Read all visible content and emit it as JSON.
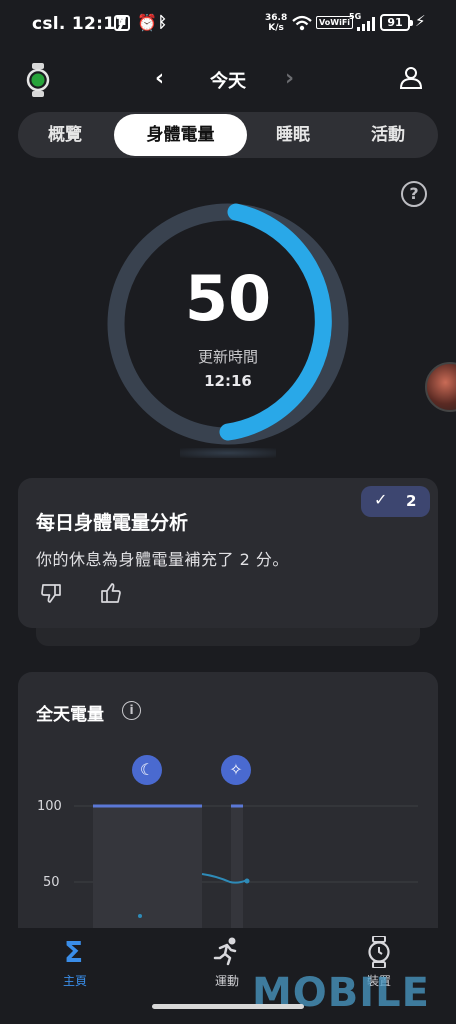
{
  "status_bar": {
    "time": "csl. 12:17",
    "net_speed_top": "36.8",
    "net_speed_unit": "K/s",
    "vowifi": "VoWiFi",
    "network": "5G",
    "battery": "91"
  },
  "header": {
    "title": "今天",
    "prev_icon": "chevron-left-icon",
    "next_icon": "chevron-right-icon",
    "watch_icon": "watch-icon",
    "profile_icon": "person-icon"
  },
  "tabs": [
    {
      "label": "概覽",
      "active": false
    },
    {
      "label": "身體電量",
      "active": true
    },
    {
      "label": "睡眠",
      "active": false
    },
    {
      "label": "活動",
      "active": false
    }
  ],
  "gauge": {
    "value": "50",
    "level_fraction": 0.5,
    "label": "更新時間",
    "time": "12:16",
    "accent": "#29a8e8"
  },
  "insight_card": {
    "title": "每日身體電量分析",
    "text": "你的休息為身體電量補充了 2 分。",
    "badge_count": "2"
  },
  "day_chart_card": {
    "title": "全天電量",
    "y_labels": [
      "100",
      "50"
    ]
  },
  "chart_data": {
    "type": "line",
    "title": "全天電量",
    "xlabel": "",
    "ylabel": "",
    "ylim": [
      0,
      100
    ],
    "yticks": [
      100,
      50
    ],
    "grid": true,
    "series": [
      {
        "values": [
          100,
          100,
          55,
          52,
          50,
          50,
          50
        ]
      }
    ]
  },
  "bottom_nav": [
    {
      "label": "主頁",
      "icon": "sigma-icon",
      "active": true
    },
    {
      "label": "運動",
      "icon": "running-icon",
      "active": false
    },
    {
      "label": "裝置",
      "icon": "watch-icon",
      "active": false
    }
  ],
  "watermark": "MOBILE"
}
